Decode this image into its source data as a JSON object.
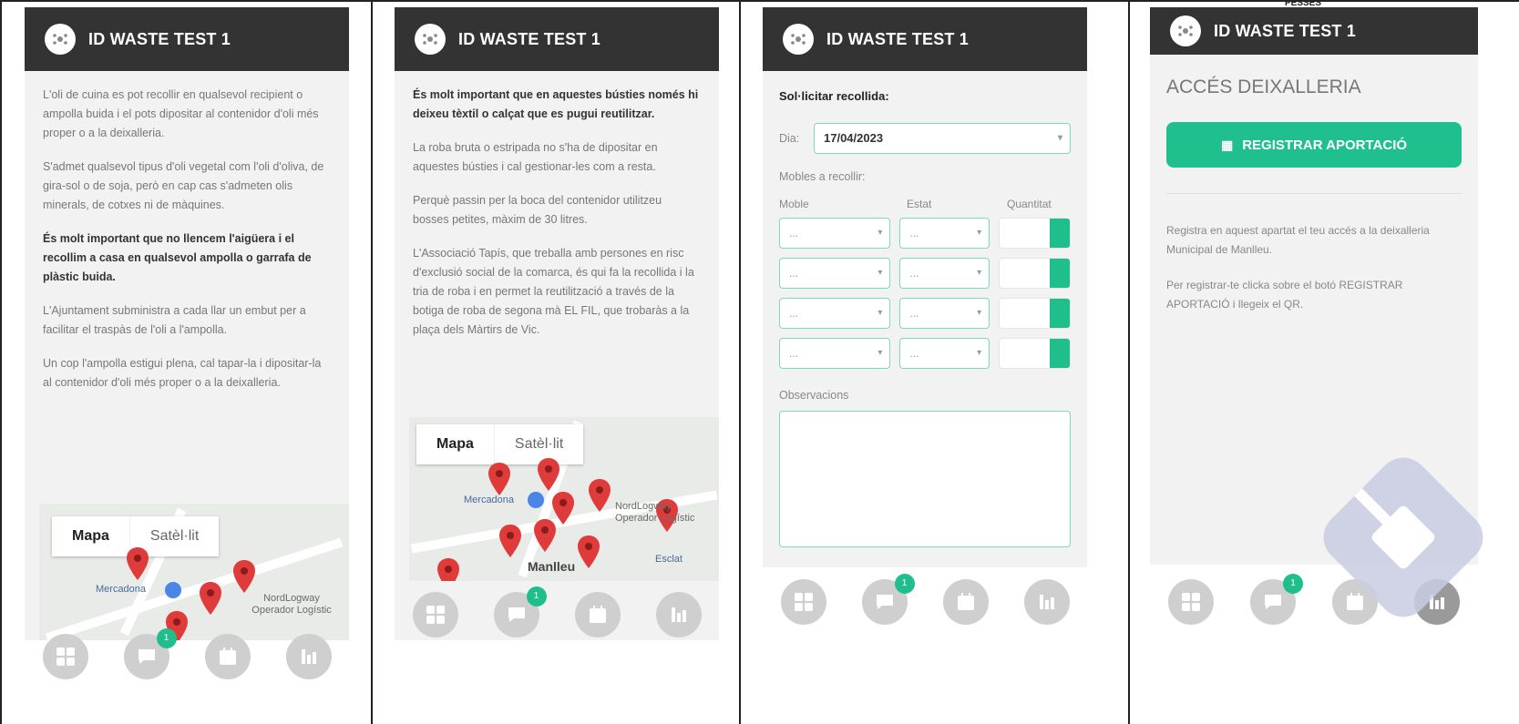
{
  "app": {
    "title": "ID WASTE TEST 1"
  },
  "top_cut_text": "PESSES",
  "screen1": {
    "paragraphs": [
      "L'oli de cuina es pot recollir en qualsevol recipient o ampolla buida i el pots dipositar al contenidor d'oli més proper o a la deixalleria.",
      "S'admet qualsevol tipus d'oli vegetal com l'oli d'oliva, de gira-sol o de soja, però en cap cas s'admeten olis minerals, de cotxes ni de màquines."
    ],
    "bold_paragraph": "És molt important que no llencem l'aigüera i el recollim a casa en qualsevol ampolla o garrafa de plàstic buida.",
    "paragraphs2": [
      "L'Ajuntament subministra a cada llar un embut per a facilitar el traspàs de l'oli a l'ampolla.",
      "Un cop l'ampolla estigui plena, cal tapar-la i dipositar-la al contenidor d'oli més proper o a la deixalleria."
    ],
    "map": {
      "tab_map": "Mapa",
      "tab_satellite": "Satèl·lit",
      "labels": {
        "store": "Mercadona",
        "company": "NordLogway Operador Logístic"
      }
    }
  },
  "screen2": {
    "bold_paragraph": "És molt important que en aquestes bústies només hi deixeu tèxtil o calçat que es pugui reutilitzar.",
    "paragraphs": [
      "La roba bruta o estripada no s'ha de dipositar en aquestes bústies i cal gestionar-les com a resta.",
      "Perquè passin per la boca del contenidor utilitzeu bosses petites, màxim de 30 litres.",
      "L'Associació Tapís, que treballa amb persones en risc d'exclusió social de la comarca, és qui fa la recollida i la tria de roba i en permet la reutilització a través de la botiga de roba de segona mà EL FIL, que trobaràs a la plaça dels Màrtirs de Vic."
    ],
    "map": {
      "tab_map": "Mapa",
      "tab_satellite": "Satèl·lit",
      "labels": {
        "store": "Mercadona",
        "company": "NordLogway Operador Logístic",
        "town": "Manlleu",
        "extra": "Esclat"
      }
    }
  },
  "screen3": {
    "title": "Sol·licitar recollida:",
    "day_label": "Dia:",
    "day_value": "17/04/2023",
    "furniture_label": "Mobles a recollir:",
    "col_item": "Moble",
    "col_state": "Estat",
    "col_qty": "Quantitat",
    "row_placeholder": "...",
    "rows": 4,
    "observations_label": "Observacions"
  },
  "screen4": {
    "heading": "ACCÉS DEIXALLERIA",
    "button": "REGISTRAR APORTACIÓ",
    "text1": "Registra en aquest apartat el teu accés a la deixalleria Municipal de Manlleu.",
    "text2": "Per registrar-te clicka sobre el botó REGISTRAR APORTACIÓ i llegeix el QR."
  },
  "nav": {
    "badge": "1"
  },
  "colors": {
    "appbar": "#333333",
    "accent": "#1fbe8c",
    "background": "#f2f2f2",
    "nav_button": "#cfcfcf"
  }
}
